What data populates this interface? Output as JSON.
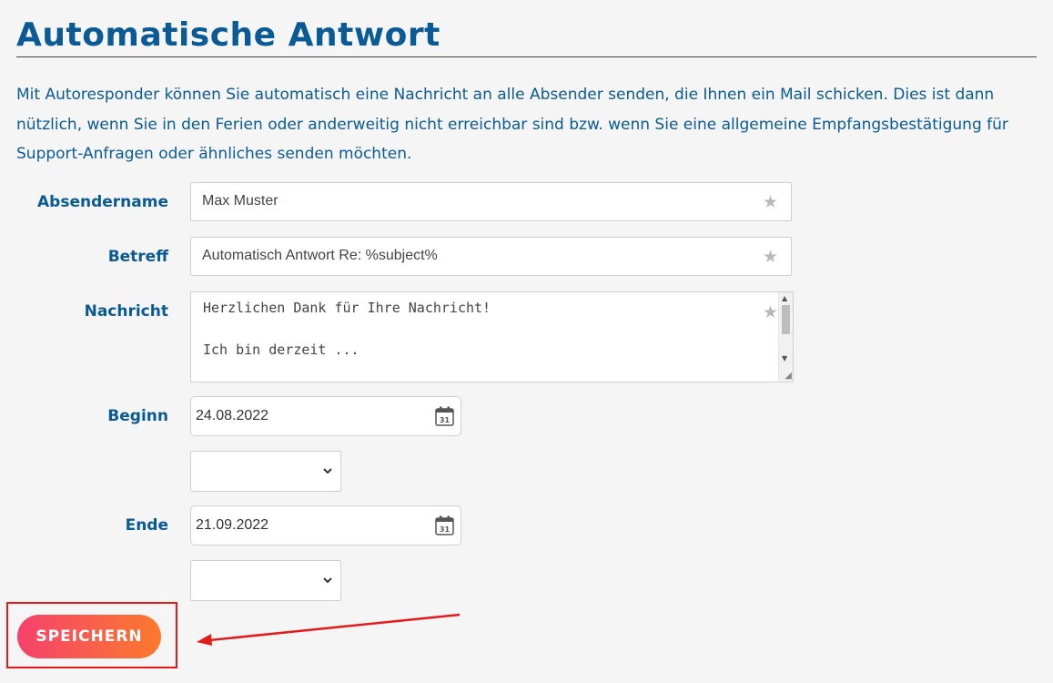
{
  "page": {
    "title": "Automatische Antwort",
    "intro": "Mit Autoresponder können Sie automatisch eine Nachricht an alle Absender senden, die Ihnen ein Mail schicken. Dies ist dann nützlich, wenn Sie in den Ferien oder anderweitig nicht erreichbar sind bzw. wenn Sie eine allgemeine Empfangsbe­stätigung für Support-Anfragen oder ähnliches senden möchten."
  },
  "form": {
    "sender_name": {
      "label": "Absendername",
      "value": "Max Muster"
    },
    "subject": {
      "label": "Betreff",
      "value": "Automatisch Antwort Re: %subject%"
    },
    "message": {
      "label": "Nachricht",
      "line1": "Herzlichen Dank für Ihre Nachricht!",
      "line2": "Ich bin derzeit ..."
    },
    "begin": {
      "label": "Beginn",
      "date": "24.08.2022",
      "time": ""
    },
    "end": {
      "label": "Ende",
      "date": "21.09.2022",
      "time": ""
    },
    "save_label": "SPEICHERN"
  },
  "icons": {
    "favorite": "star-icon",
    "calendar": "calendar-icon",
    "dropdown": "chevron-down-icon"
  },
  "colors": {
    "heading": "#0a5a96",
    "button_gradient_start": "#f6416c",
    "button_gradient_end": "#fb7a2c",
    "annotation": "#e41b1b"
  }
}
